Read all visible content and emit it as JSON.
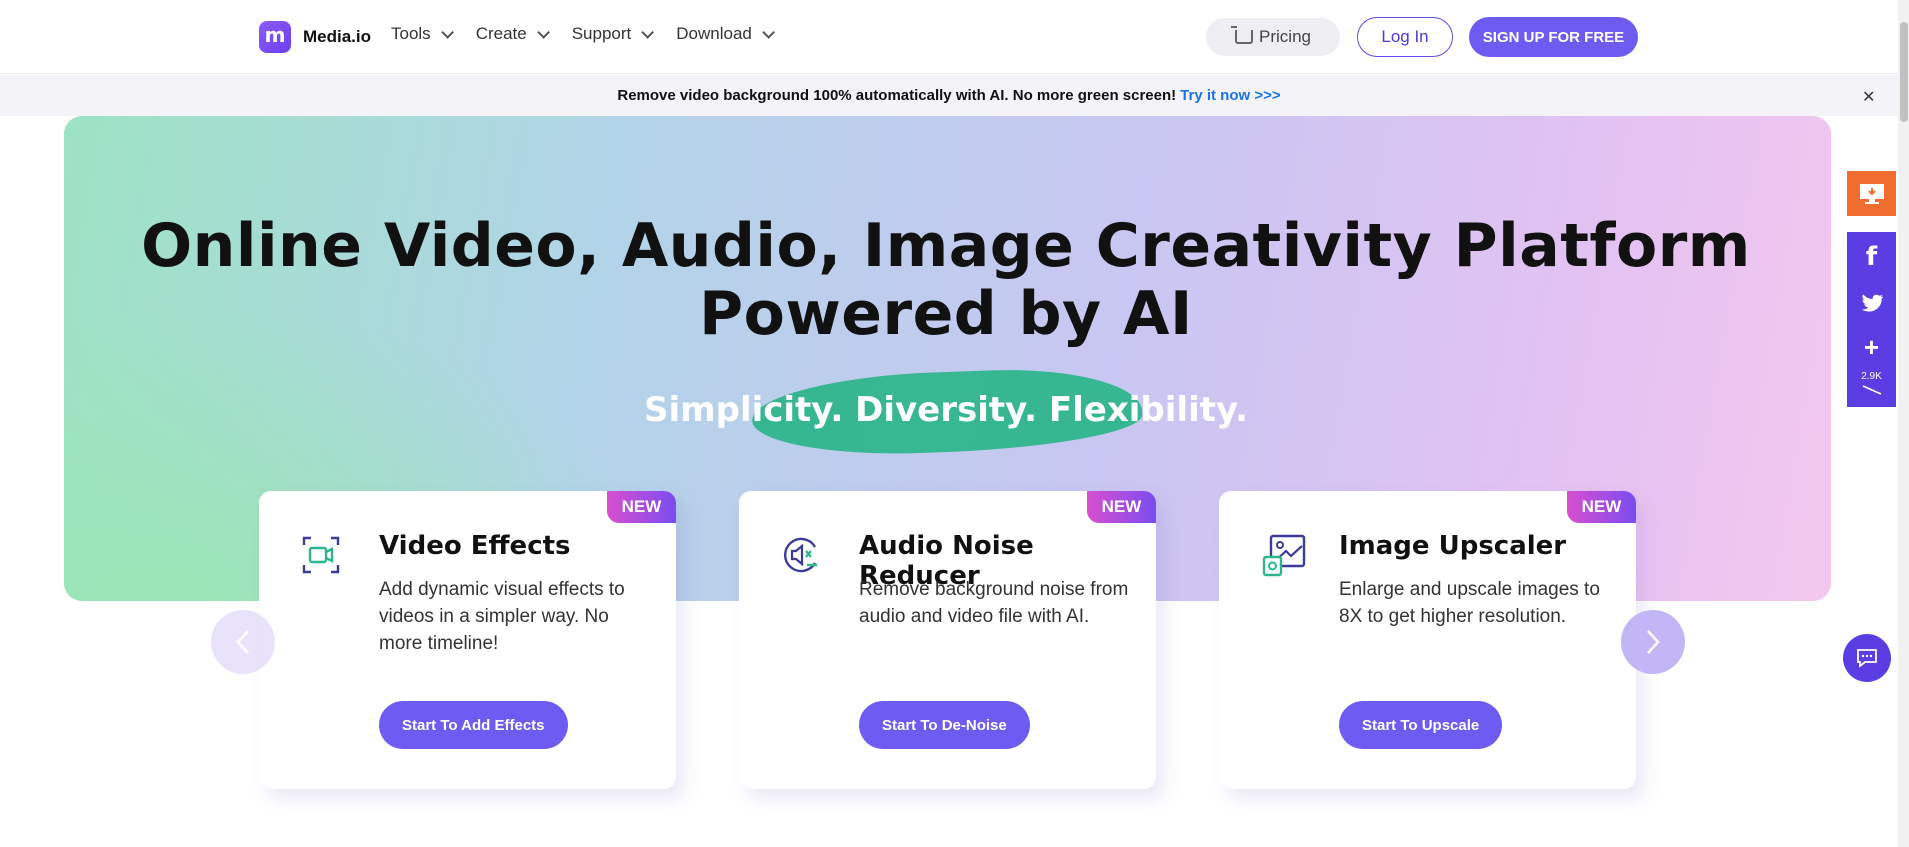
{
  "nav": {
    "logo_text": "Media.io",
    "menu": [
      "Tools",
      "Create",
      "Support",
      "Download"
    ],
    "pricing": "Pricing",
    "login": "Log In",
    "signup": "SIGN UP FOR FREE"
  },
  "banner": {
    "text": "Remove video background 100% automatically with AI. No more green screen!",
    "link": "Try it now >>>",
    "close": "✕"
  },
  "hero": {
    "title_line1": "Online Video, Audio, Image Creativity Platform",
    "title_line2": "Powered by AI",
    "tagline": "Simplicity. Diversity. Flexibility."
  },
  "cards": [
    {
      "badge": "NEW",
      "title": "Video Effects",
      "desc": "Add dynamic visual effects to videos in a simpler way. No more timeline!",
      "button": "Start To Add Effects",
      "icon": "video-effects-icon"
    },
    {
      "badge": "NEW",
      "title": "Audio Noise Reducer",
      "desc": "Remove background noise from audio and video file with AI.",
      "button": "Start To De-Noise",
      "icon": "audio-noise-icon"
    },
    {
      "badge": "NEW",
      "title": "Image Upscaler",
      "desc": "Enlarge and upscale images to 8X to get higher resolution.",
      "button": "Start To Upscale",
      "icon": "image-upscale-icon"
    }
  ],
  "share": {
    "count": "2.9K",
    "brand_colors": {
      "orange": "#f06d2f",
      "purple": "#5a3de3"
    }
  },
  "colors": {
    "accent": "#6e5cf2",
    "link": "#1a73e8"
  }
}
